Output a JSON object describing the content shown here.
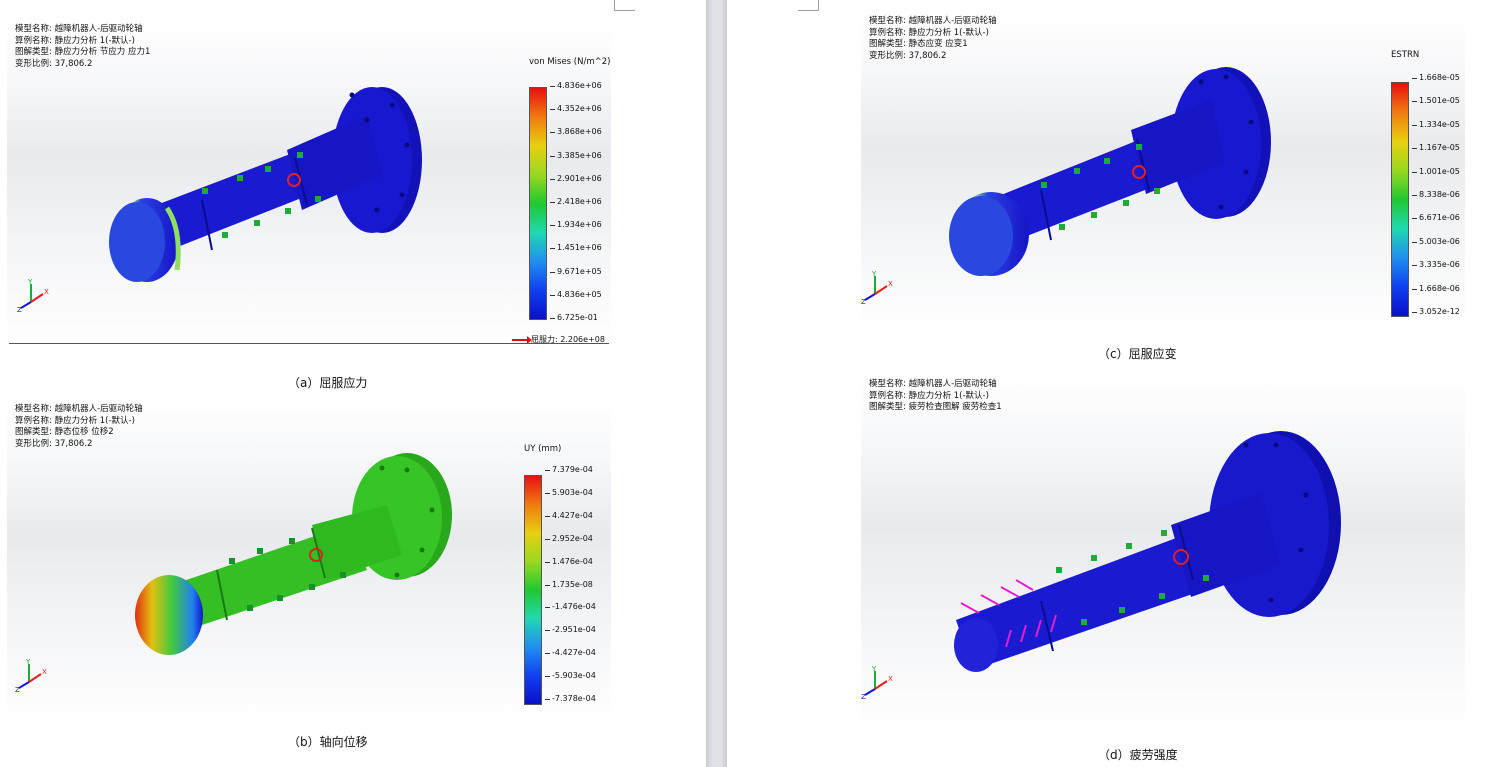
{
  "panels": {
    "a": {
      "info": [
        "模型名称: 越障机器人-后驱动轮轴",
        "算例名称: 静应力分析 1(-默认-)",
        "图解类型: 静应力分析 节应力 应力1",
        "变形比例: 37,806.2"
      ],
      "legend_title": "von Mises (N/m^2)",
      "ticks": [
        "4.836e+06",
        "4.352e+06",
        "3.868e+06",
        "3.385e+06",
        "2.901e+06",
        "2.418e+06",
        "1.934e+06",
        "1.451e+06",
        "9.671e+05",
        "4.836e+05",
        "6.725e-01"
      ],
      "yield_label": "屈服力: 2.206e+08",
      "caption": "（a）屈服应力"
    },
    "b": {
      "info": [
        "模型名称: 越障机器人-后驱动轮轴",
        "算例名称: 静应力分析 1(-默认-)",
        "图解类型: 静态位移 位移2",
        "变形比例: 37,806.2"
      ],
      "legend_title": "UY (mm)",
      "ticks": [
        "7.379e-04",
        "5.903e-04",
        "4.427e-04",
        "2.952e-04",
        "1.476e-04",
        "1.735e-08",
        "-1.476e-04",
        "-2.951e-04",
        "-4.427e-04",
        "-5.903e-04",
        "-7.378e-04"
      ],
      "caption": "（b）轴向位移"
    },
    "c": {
      "info": [
        "模型名称: 越障机器人-后驱动轮轴",
        "算例名称: 静应力分析 1(-默认-)",
        "图解类型: 静态应变 应变1",
        "变形比例: 37,806.2"
      ],
      "legend_title": "ESTRN",
      "ticks": [
        "1.668e-05",
        "1.501e-05",
        "1.334e-05",
        "1.167e-05",
        "1.001e-05",
        "8.338e-06",
        "6.671e-06",
        "5.003e-06",
        "3.335e-06",
        "1.668e-06",
        "3.052e-12"
      ],
      "caption": "（c）屈服应变"
    },
    "d": {
      "info": [
        "模型名称: 越障机器人-后驱动轮轴",
        "算例名称: 静应力分析 1(-默认-)",
        "图解类型: 疲劳检查图解 疲劳检查1"
      ],
      "caption": "（d）疲劳强度"
    }
  },
  "triad": {
    "x": "X",
    "y": "Y",
    "z": "Z"
  },
  "colors": {
    "shaft_blue": "#1414d8",
    "shaft_green": "#2fbf1f",
    "arrow_magenta": "#e020d0",
    "fixture_green": "#1faa3a",
    "torque_red": "#e02020"
  }
}
